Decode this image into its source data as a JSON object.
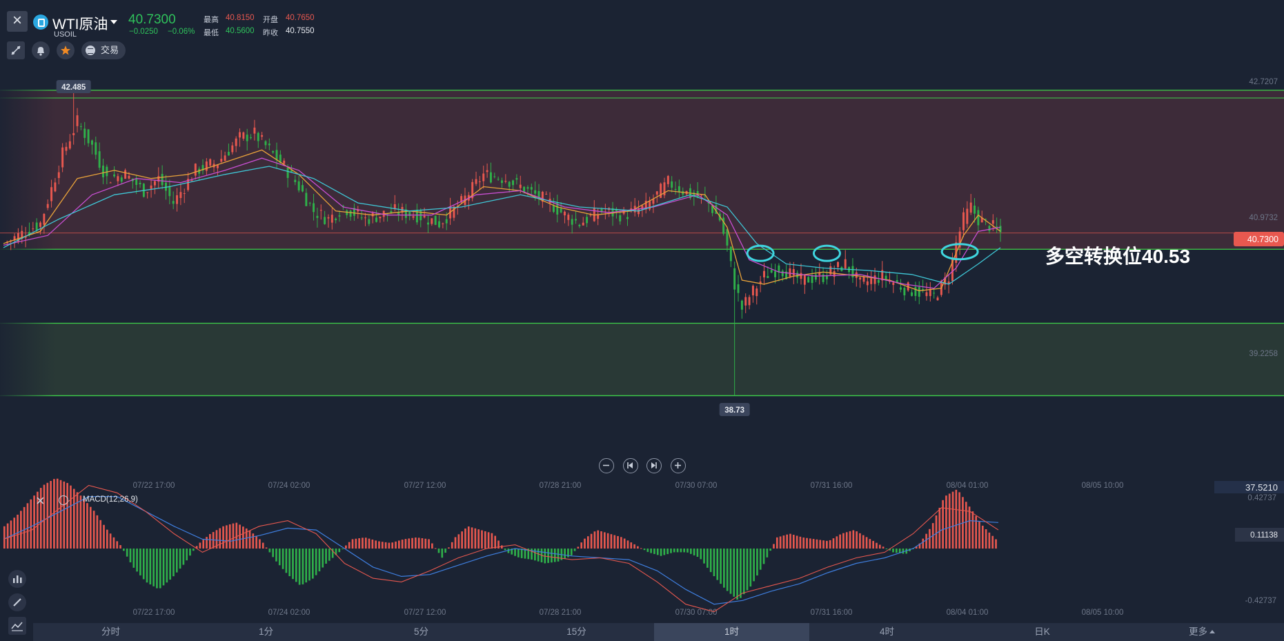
{
  "symbol": {
    "name": "WTI原油",
    "code": "USOIL",
    "price": "40.7300",
    "change": "−0.0250",
    "change_pct": "−0.06%"
  },
  "stats": {
    "high_label": "最高",
    "high": "40.8150",
    "open_label": "开盘",
    "open": "40.7650",
    "low_label": "最低",
    "low": "40.5600",
    "prev_label": "昨收",
    "prev": "40.7550"
  },
  "toolbar": {
    "trade_label": "交易"
  },
  "colors": {
    "up": "#e8584f",
    "down": "#2fb14a",
    "ma5": "#e8a23a",
    "ma10": "#c84fd2",
    "ma20": "#3fc7d6",
    "resist_zone": "#4a2f3c",
    "support_zone": "#2f4138",
    "band_line": "#3fd14a",
    "bg": "#1b2333"
  },
  "chart_data": [
    {
      "type": "candlestick",
      "title": "",
      "price_axis": {
        "ticks": [
          "42.7207",
          "40.9732",
          "39.2258"
        ],
        "current_price": "40.7300"
      },
      "x_axis_ticks": [
        "07/22 17:00",
        "07/24 02:00",
        "07/27 12:00",
        "07/28 21:00",
        "07/30 07:00",
        "07/31 16:00",
        "08/04 01:00",
        "08/05 10:00"
      ],
      "max_label": "42.485",
      "min_label": "38.73",
      "annotation": "多空转换位40.53",
      "zones": [
        {
          "name": "resistance",
          "from": 40.53,
          "to": 42.485
        },
        {
          "name": "support",
          "from": 38.73,
          "to": 39.62
        }
      ],
      "close_path": [
        [
          0,
          40.6
        ],
        [
          10,
          40.85
        ],
        [
          16,
          41.7
        ],
        [
          20,
          42.1
        ],
        [
          24,
          41.8
        ],
        [
          28,
          41.4
        ],
        [
          33,
          41.45
        ],
        [
          38,
          41.25
        ],
        [
          42,
          41.4
        ],
        [
          46,
          41.1
        ],
        [
          52,
          41.5
        ],
        [
          58,
          41.6
        ],
        [
          64,
          41.9
        ],
        [
          68,
          41.95
        ],
        [
          72,
          41.75
        ],
        [
          76,
          41.55
        ],
        [
          80,
          41.3
        ],
        [
          84,
          41.0
        ],
        [
          88,
          40.9
        ],
        [
          92,
          41.05
        ],
        [
          98,
          40.9
        ],
        [
          106,
          41.0
        ],
        [
          112,
          40.95
        ],
        [
          118,
          40.85
        ],
        [
          124,
          41.1
        ],
        [
          130,
          41.45
        ],
        [
          136,
          41.4
        ],
        [
          142,
          41.25
        ],
        [
          148,
          41.1
        ],
        [
          152,
          40.95
        ],
        [
          156,
          40.85
        ],
        [
          162,
          41.0
        ],
        [
          168,
          40.95
        ],
        [
          174,
          41.05
        ],
        [
          180,
          41.35
        ],
        [
          186,
          41.2
        ],
        [
          190,
          41.15
        ],
        [
          194,
          40.9
        ],
        [
          196,
          40.55
        ],
        [
          198,
          40.1
        ],
        [
          200,
          39.8
        ],
        [
          202,
          39.95
        ],
        [
          206,
          40.2
        ],
        [
          210,
          40.3
        ],
        [
          216,
          40.15
        ],
        [
          222,
          40.2
        ],
        [
          228,
          40.35
        ],
        [
          232,
          40.1
        ],
        [
          238,
          40.2
        ],
        [
          244,
          40.05
        ],
        [
          248,
          40.0
        ],
        [
          252,
          39.95
        ],
        [
          256,
          40.2
        ],
        [
          258,
          40.6
        ],
        [
          260,
          40.9
        ],
        [
          262,
          41.05
        ],
        [
          264,
          40.9
        ],
        [
          266,
          40.85
        ],
        [
          268,
          40.8
        ],
        [
          270,
          40.73
        ]
      ],
      "ma_series": [
        {
          "name": "",
          "values": [
            [
              0,
              40.6
            ],
            [
              10,
              40.75
            ],
            [
              20,
              41.4
            ],
            [
              30,
              41.5
            ],
            [
              40,
              41.4
            ],
            [
              50,
              41.45
            ],
            [
              60,
              41.6
            ],
            [
              70,
              41.75
            ],
            [
              80,
              41.45
            ],
            [
              90,
              41.0
            ],
            [
              100,
              40.95
            ],
            [
              110,
              41.0
            ],
            [
              120,
              40.95
            ],
            [
              130,
              41.3
            ],
            [
              140,
              41.25
            ],
            [
              150,
              41.05
            ],
            [
              160,
              40.95
            ],
            [
              170,
              41.0
            ],
            [
              180,
              41.25
            ],
            [
              190,
              41.2
            ],
            [
              196,
              40.8
            ],
            [
              200,
              40.15
            ],
            [
              206,
              40.1
            ],
            [
              214,
              40.2
            ],
            [
              222,
              40.25
            ],
            [
              232,
              40.2
            ],
            [
              240,
              40.15
            ],
            [
              248,
              40.02
            ],
            [
              254,
              40.05
            ],
            [
              260,
              40.7
            ],
            [
              264,
              40.95
            ],
            [
              270,
              40.75
            ]
          ]
        },
        {
          "name": "",
          "values": [
            [
              0,
              40.58
            ],
            [
              12,
              40.7
            ],
            [
              24,
              41.2
            ],
            [
              36,
              41.4
            ],
            [
              48,
              41.35
            ],
            [
              60,
              41.5
            ],
            [
              70,
              41.65
            ],
            [
              80,
              41.5
            ],
            [
              92,
              41.05
            ],
            [
              104,
              40.95
            ],
            [
              116,
              40.95
            ],
            [
              128,
              41.2
            ],
            [
              140,
              41.25
            ],
            [
              152,
              41.05
            ],
            [
              164,
              40.98
            ],
            [
              176,
              41.05
            ],
            [
              188,
              41.2
            ],
            [
              196,
              40.95
            ],
            [
              202,
              40.4
            ],
            [
              210,
              40.25
            ],
            [
              220,
              40.2
            ],
            [
              232,
              40.22
            ],
            [
              244,
              40.1
            ],
            [
              252,
              40.05
            ],
            [
              258,
              40.3
            ],
            [
              264,
              40.75
            ],
            [
              270,
              40.8
            ]
          ]
        },
        {
          "name": "",
          "values": [
            [
              0,
              40.55
            ],
            [
              15,
              40.9
            ],
            [
              30,
              41.2
            ],
            [
              45,
              41.3
            ],
            [
              60,
              41.45
            ],
            [
              72,
              41.55
            ],
            [
              84,
              41.4
            ],
            [
              96,
              41.1
            ],
            [
              110,
              41.0
            ],
            [
              124,
              41.05
            ],
            [
              140,
              41.2
            ],
            [
              156,
              41.05
            ],
            [
              172,
              41.0
            ],
            [
              186,
              41.2
            ],
            [
              196,
              41.05
            ],
            [
              204,
              40.6
            ],
            [
              212,
              40.35
            ],
            [
              222,
              40.3
            ],
            [
              234,
              40.27
            ],
            [
              246,
              40.22
            ],
            [
              256,
              40.1
            ],
            [
              264,
              40.35
            ],
            [
              270,
              40.55
            ]
          ]
        }
      ]
    },
    {
      "type": "macd",
      "title": "MACD(12,26,9)",
      "axis_ticks": [
        "0.42737",
        "0.11138",
        "-0.42737"
      ],
      "extra_value": "37.5210",
      "histogram": [
        0.12,
        0.18,
        0.26,
        0.34,
        0.38,
        0.35,
        0.28,
        0.2,
        0.1,
        0.02,
        -0.1,
        -0.18,
        -0.22,
        -0.16,
        -0.08,
        0.02,
        0.08,
        0.12,
        0.14,
        0.1,
        0.04,
        -0.06,
        -0.14,
        -0.2,
        -0.16,
        -0.08,
        -0.02,
        0.05,
        0.06,
        0.04,
        0.03,
        0.05,
        0.06,
        0.05,
        -0.05,
        0.06,
        0.12,
        0.1,
        0.08,
        -0.02,
        -0.05,
        -0.06,
        -0.08,
        -0.07,
        -0.04,
        0.05,
        0.1,
        0.08,
        0.06,
        0.02,
        -0.02,
        -0.04,
        -0.02,
        -0.02,
        -0.05,
        -0.14,
        -0.22,
        -0.28,
        -0.2,
        -0.08,
        0.06,
        0.08,
        0.06,
        0.05,
        0.04,
        0.08,
        0.1,
        0.06,
        0.02,
        -0.02,
        -0.03,
        0.02,
        0.12,
        0.28,
        0.32,
        0.22,
        0.12,
        0.05
      ],
      "macd_line": [
        0.05,
        0.1,
        0.22,
        0.34,
        0.3,
        0.2,
        0.08,
        -0.02,
        0.05,
        0.12,
        0.15,
        0.08,
        -0.08,
        -0.16,
        -0.18,
        -0.12,
        -0.05,
        0.0,
        0.02,
        -0.04,
        -0.06,
        -0.05,
        -0.08,
        -0.18,
        -0.3,
        -0.34,
        -0.24,
        -0.2,
        -0.16,
        -0.1,
        -0.05,
        -0.02,
        0.08,
        0.22,
        0.2,
        0.1
      ],
      "signal_line": [
        0.05,
        0.12,
        0.2,
        0.28,
        0.28,
        0.2,
        0.12,
        0.05,
        0.04,
        0.07,
        0.11,
        0.1,
        0.0,
        -0.1,
        -0.15,
        -0.14,
        -0.09,
        -0.04,
        0.0,
        -0.02,
        -0.04,
        -0.05,
        -0.06,
        -0.12,
        -0.22,
        -0.3,
        -0.28,
        -0.23,
        -0.19,
        -0.13,
        -0.08,
        -0.05,
        0.0,
        0.1,
        0.15,
        0.14
      ]
    }
  ],
  "tabs": [
    "分时",
    "1分",
    "5分",
    "15分",
    "1时",
    "4时",
    "日K",
    "更多"
  ],
  "active_tab": "1时"
}
